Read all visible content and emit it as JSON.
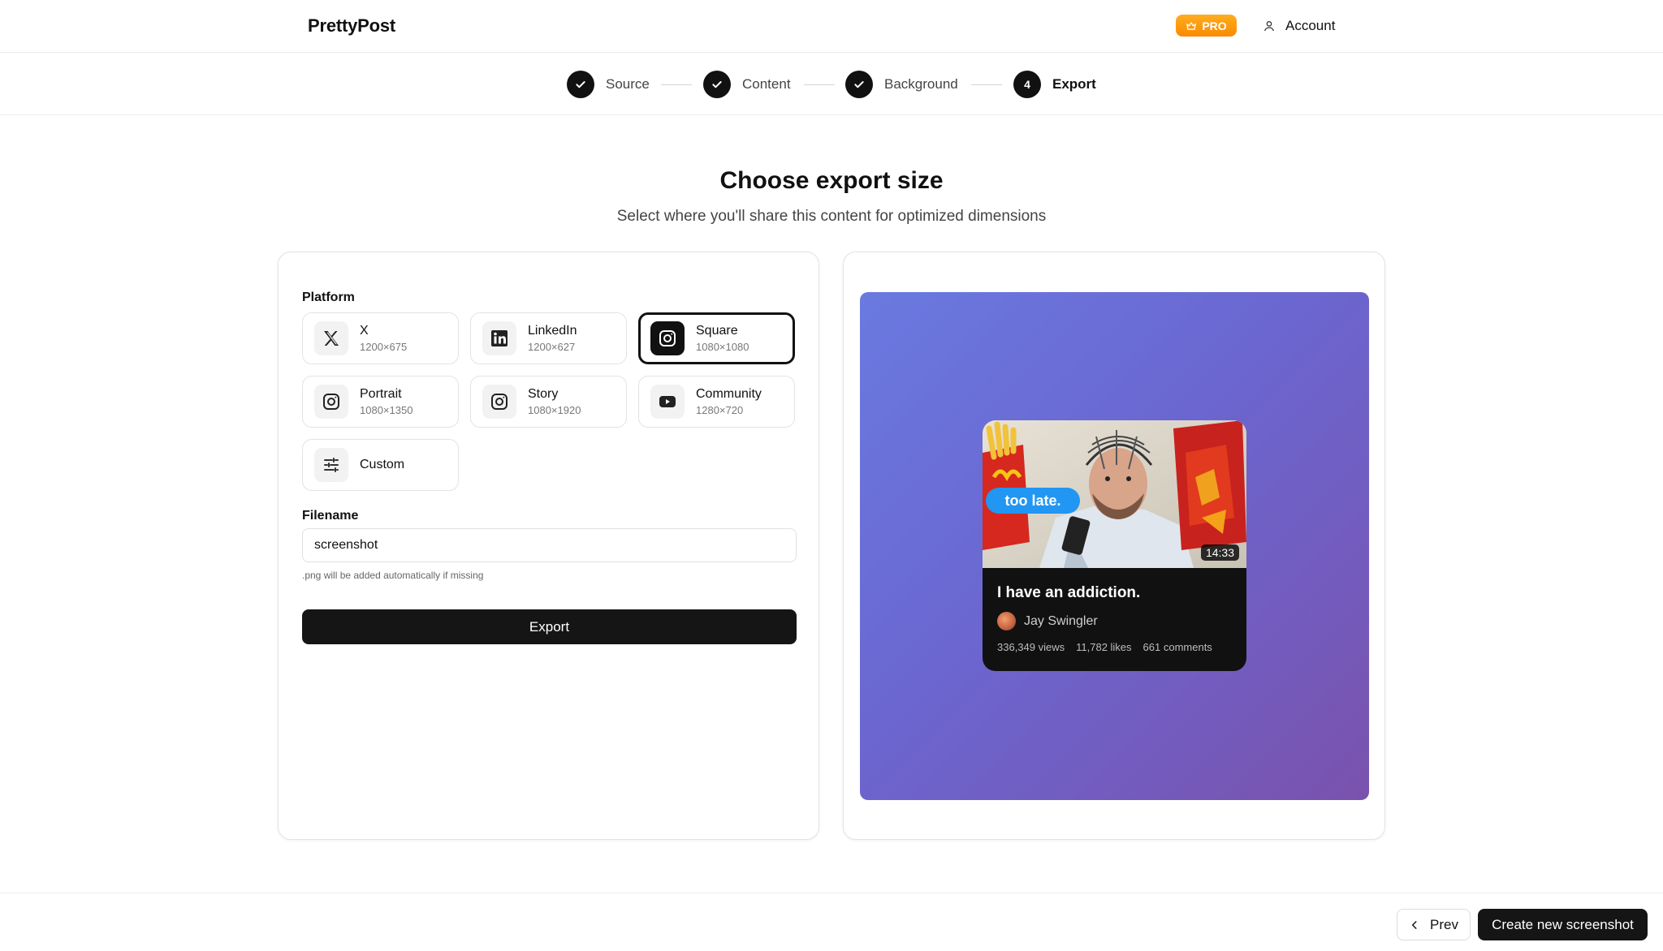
{
  "app": {
    "name": "PrettyPost",
    "pro_label": "PRO",
    "account_label": "Account"
  },
  "stepper": {
    "steps": [
      {
        "label": "Source",
        "state": "done"
      },
      {
        "label": "Content",
        "state": "done"
      },
      {
        "label": "Background",
        "state": "done"
      },
      {
        "label": "Export",
        "state": "active",
        "number": "4"
      }
    ]
  },
  "main": {
    "title": "Choose export size",
    "subtitle": "Select where you'll share this content for optimized dimensions"
  },
  "platform": {
    "label": "Platform",
    "selected": "Square",
    "options": [
      {
        "name": "X",
        "dims": "1200×675",
        "icon": "x-logo-icon"
      },
      {
        "name": "LinkedIn",
        "dims": "1200×627",
        "icon": "linkedin-icon"
      },
      {
        "name": "Square",
        "dims": "1080×1080",
        "icon": "instagram-icon"
      },
      {
        "name": "Portrait",
        "dims": "1080×1350",
        "icon": "instagram-icon"
      },
      {
        "name": "Story",
        "dims": "1080×1920",
        "icon": "instagram-icon"
      },
      {
        "name": "Community",
        "dims": "1280×720",
        "icon": "youtube-icon"
      },
      {
        "name": "Custom",
        "dims": "",
        "icon": "sliders-icon"
      }
    ]
  },
  "filename": {
    "label": "Filename",
    "value": "screenshot",
    "hint": ".png will be added automatically if missing"
  },
  "export_button": "Export",
  "preview": {
    "video_title": "I have an addiction.",
    "author": "Jay Swingler",
    "duration": "14:33",
    "thumbnail_caption": "too late.",
    "views": "336,349 views",
    "likes": "11,782 likes",
    "comments": "661 comments"
  },
  "footer": {
    "prev_label": "Prev",
    "create_label": "Create new screenshot"
  },
  "colors": {
    "accent": "#111111",
    "pro_badge": "#f98a00",
    "preview_gradient_start": "#6a7ae0",
    "preview_gradient_end": "#7a52ad"
  }
}
